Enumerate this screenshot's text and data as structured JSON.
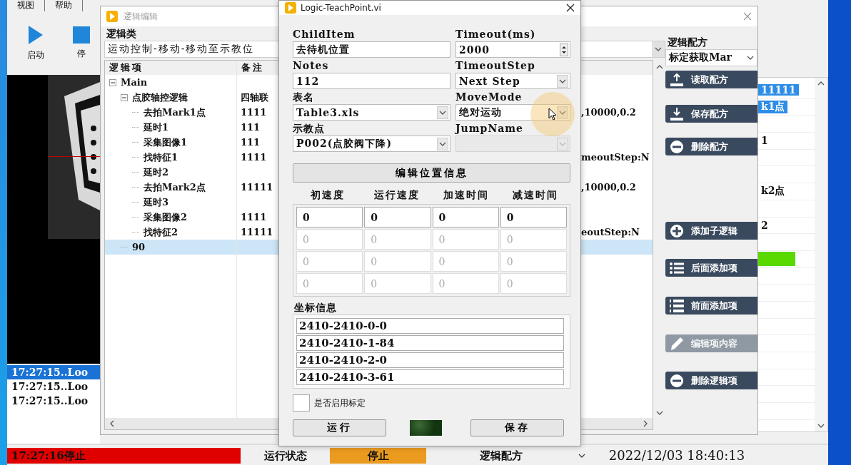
{
  "main_window": {
    "menu_tabs": [
      {
        "label": "视图"
      },
      {
        "label": "帮助"
      }
    ],
    "toolbar": [
      {
        "label": "启动",
        "kind": "play"
      },
      {
        "label": "停",
        "kind": "stop"
      }
    ],
    "log": [
      {
        "text": "17:27:15..Loo",
        "selected": true
      },
      {
        "text": "17:27:15..Loo",
        "selected": false
      },
      {
        "text": "17:27:15..Loo",
        "selected": false
      }
    ],
    "side_list": [
      {
        "kind": "text",
        "text": "11111",
        "selected": true
      },
      {
        "kind": "text",
        "text": "k1点",
        "selected": true
      },
      {
        "kind": "blank"
      },
      {
        "kind": "text",
        "text": "1",
        "selected": false
      },
      {
        "kind": "blank"
      },
      {
        "kind": "blank"
      },
      {
        "kind": "text",
        "text": "k2点",
        "selected": false
      },
      {
        "kind": "blank"
      },
      {
        "kind": "text",
        "text": "2",
        "selected": false
      },
      {
        "kind": "blank"
      },
      {
        "kind": "bar",
        "color": "#5ad900"
      },
      {
        "kind": "blank"
      },
      {
        "kind": "blank"
      },
      {
        "kind": "blank"
      },
      {
        "kind": "blank"
      },
      {
        "kind": "blank"
      },
      {
        "kind": "blank"
      },
      {
        "kind": "blank"
      },
      {
        "kind": "blank"
      },
      {
        "kind": "blank"
      }
    ],
    "status_bar": {
      "message": "17:27:16停止",
      "state_label": "运行状态",
      "state": "停止",
      "recipe_label": "逻辑配方",
      "datetime": "2022/12/03 18:40:13"
    }
  },
  "logic_editor": {
    "title": "逻辑编辑",
    "category_label": "逻辑类",
    "category": "运动控制-移动-移动至示教位",
    "columns": [
      "逻辑项",
      "备注"
    ],
    "tree": [
      {
        "label": "Main",
        "expanded": true,
        "selected": false,
        "children": [
          {
            "label": "点胶轴控逻辑",
            "note": "四轴联",
            "expanded": true,
            "selected": false,
            "children": [
              {
                "label": "去拍Mark1点",
                "note": "1111",
                "column_3": ",10000,0.2",
                "selected": false
              },
              {
                "label": "延时1",
                "note": "111",
                "selected": false
              },
              {
                "label": "采集图像1",
                "note": "111",
                "selected": false
              },
              {
                "label": "找特征1",
                "note": "1111",
                "column_3": "meoutStep:N",
                "selected": false
              },
              {
                "label": "延时2",
                "selected": false
              },
              {
                "label": "去拍Mark2点",
                "note": "11111",
                "column_3": ",10000,0.2",
                "selected": false
              },
              {
                "label": "延时3",
                "selected": false
              },
              {
                "label": "采集图像2",
                "note": "1111",
                "selected": false
              },
              {
                "label": "找特征2",
                "note": "11111",
                "column_3": "eoutStep:N",
                "selected": false
              }
            ]
          },
          {
            "label": "90",
            "selected": true
          }
        ]
      }
    ],
    "recipe_label": "逻辑配方",
    "recipe": "标定获取Mar",
    "buttons": [
      {
        "label": "读取配方",
        "disabled": false
      },
      {
        "label": "保存配方",
        "disabled": false
      },
      {
        "label": "删除配方",
        "disabled": false
      },
      {
        "label": "添加子逻辑",
        "disabled": false
      },
      {
        "label": "后面添加项",
        "disabled": false
      },
      {
        "label": "前面添加项",
        "disabled": false
      },
      {
        "label": "编辑项内容",
        "disabled": true
      },
      {
        "label": "删除逻辑项",
        "disabled": false
      }
    ]
  },
  "dialog": {
    "title": "Logic-TeachPoint.vi",
    "fields": [
      {
        "label": "ChildItem",
        "value": "去待机位置",
        "kind": "text",
        "disabled": false
      },
      {
        "label": "Timeout(ms)",
        "value": "2000",
        "kind": "spinner",
        "disabled": false
      },
      {
        "label": "Notes",
        "value": "112",
        "kind": "text",
        "disabled": false
      },
      {
        "label": "TimeoutStep",
        "value": "Next Step",
        "kind": "dropdown",
        "disabled": false
      },
      {
        "label": "表名",
        "value": "Table3.xls",
        "kind": "dropdown",
        "disabled": false
      },
      {
        "label": "MoveMode",
        "value": "绝对运动",
        "kind": "dropdown",
        "disabled": false
      },
      {
        "label": "示教点",
        "value": "P002(点胶阀下降)",
        "kind": "dropdown",
        "disabled": false
      },
      {
        "label": "JumpName",
        "kind": "dropdown",
        "disabled": true
      }
    ],
    "edit_button": "编辑位置信息",
    "speed_columns": [
      "初速度",
      "运行速度",
      "加速时间",
      "减速时间"
    ],
    "speed_rows": [
      {
        "values": [
          "0",
          "0",
          "0",
          "0"
        ],
        "disabled": false
      },
      {
        "values": [
          "0",
          "0",
          "0",
          "0"
        ],
        "disabled": true
      },
      {
        "values": [
          "0",
          "0",
          "0",
          "0"
        ],
        "disabled": true
      },
      {
        "values": [
          "0",
          "0",
          "0",
          "0"
        ],
        "disabled": true
      }
    ],
    "coord_label": "坐标信息",
    "coords": [
      "2410-2410-0-0",
      "2410-2410-1-84",
      "2410-2410-2-0",
      "2410-2410-3-61"
    ],
    "calibration": {
      "label": "是否启用标定",
      "checked": false
    },
    "run_button": "运行",
    "indicator": {
      "on": false
    },
    "save_button": "保存"
  }
}
